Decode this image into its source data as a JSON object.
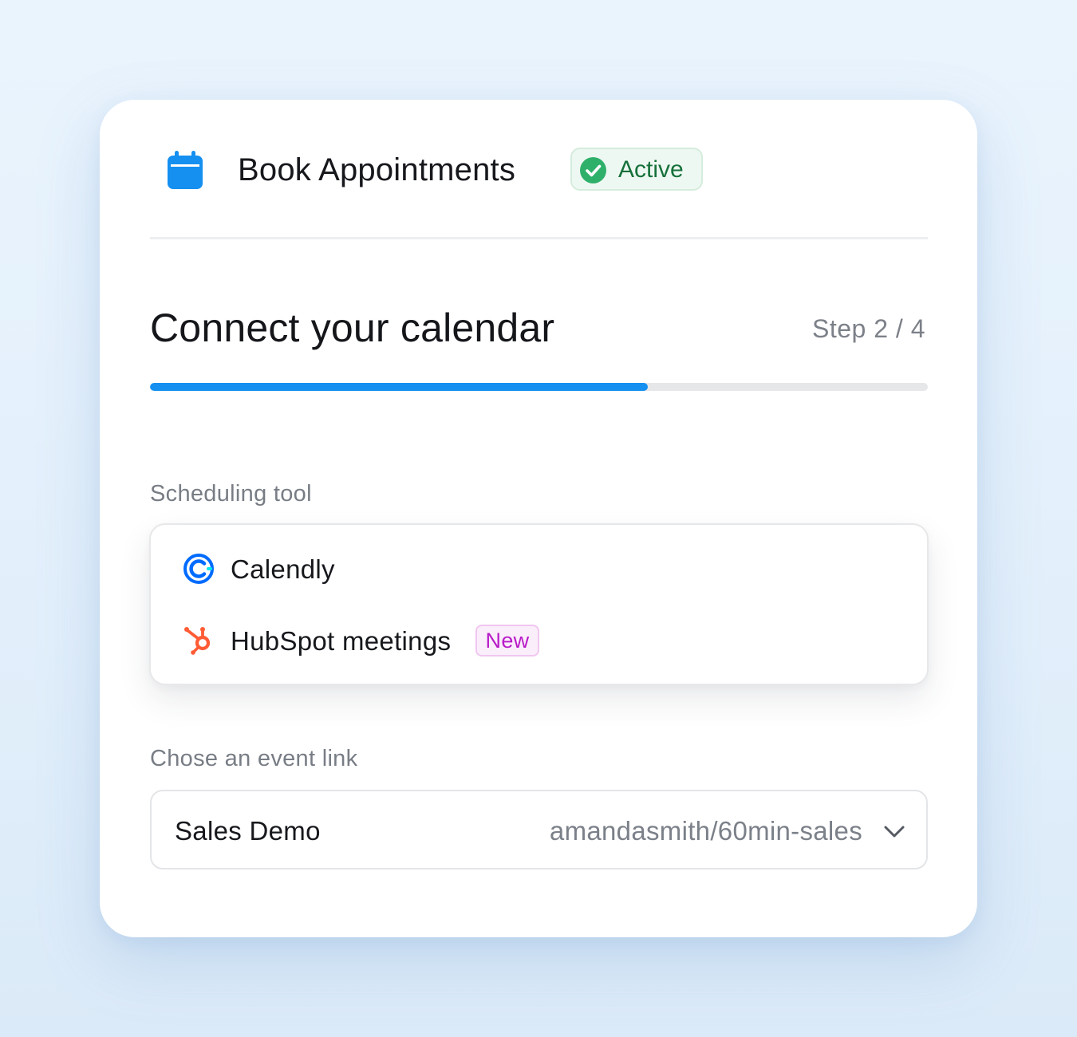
{
  "header": {
    "icon": "calendar-icon",
    "title": "Book Appointments",
    "status": {
      "label": "Active",
      "icon": "check-circle-icon",
      "color": "#2fb06a"
    }
  },
  "step_section": {
    "title": "Connect your calendar",
    "step_text": "Step 2 / 4",
    "progress": 0.64,
    "progress_color": "#1590f0"
  },
  "scheduling_tool": {
    "label": "Scheduling tool",
    "options": [
      {
        "label": "Calendly",
        "icon": "calendly-logo-icon"
      },
      {
        "label": "HubSpot meetings",
        "icon": "hubspot-logo-icon",
        "badge": "New"
      }
    ]
  },
  "event_link": {
    "label": "Chose an event link",
    "selected_name": "Sales Demo",
    "selected_link": "amandasmith/60min-sales",
    "icon": "chevron-down-icon"
  },
  "colors": {
    "accent": "#1590f0",
    "success": "#16713b",
    "new_badge": "#b81bc8",
    "hubspot": "#ff5c35"
  }
}
